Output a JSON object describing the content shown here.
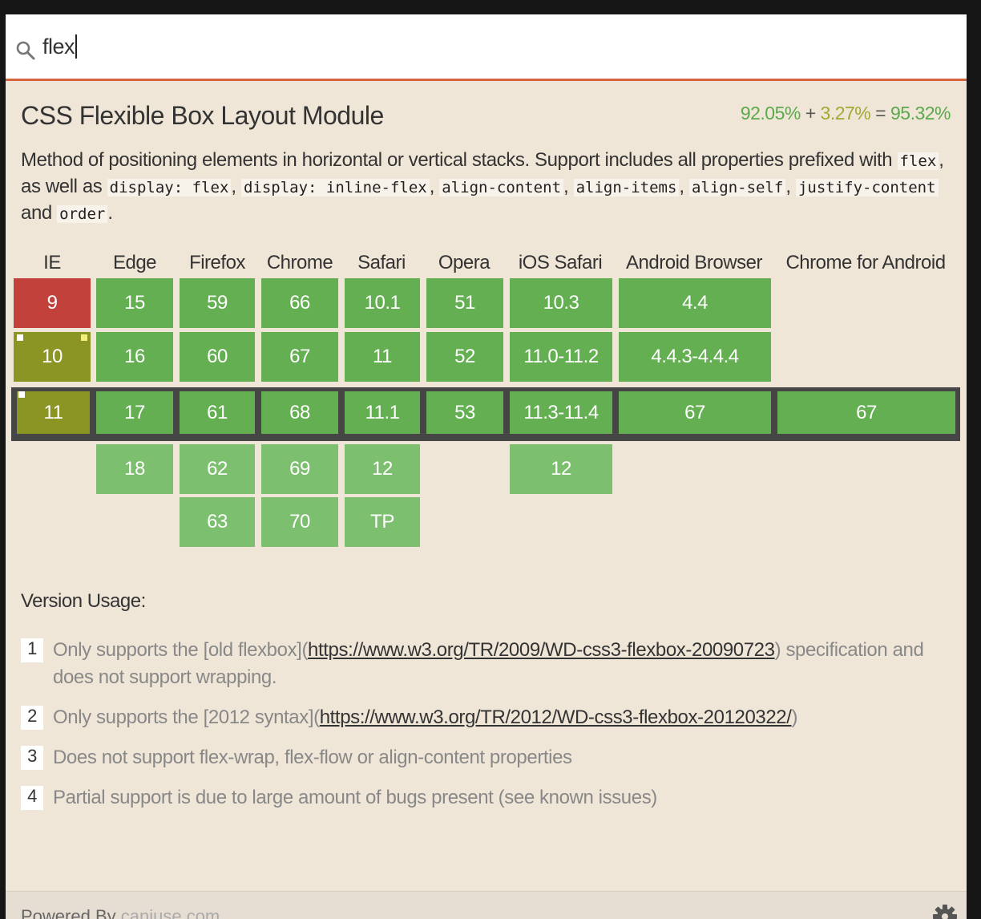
{
  "search": {
    "value": "flex"
  },
  "feature": {
    "title": "CSS Flexible Box Layout Module",
    "usage": {
      "supported": "92.05%",
      "plus": "+",
      "partial": "3.27%",
      "equals": "=",
      "total": "95.32%"
    },
    "description": {
      "prefix": "Method of positioning elements in horizontal or vertical stacks. Support includes all properties prefixed with",
      "code_flex": "flex",
      "as_well_as": ", as well as",
      "code_display_flex": "display: flex",
      "code_display_inline_flex": "display: inline-flex",
      "code_align_content": "align-content",
      "code_align_items": "align-items",
      "code_align_self": "align-self",
      "code_justify_content": "justify-content",
      "and": "and",
      "code_order": "order",
      "comma": ",",
      "period": "."
    }
  },
  "browsers": [
    {
      "name": "IE",
      "versions": {
        "past1": "9",
        "past2": "10",
        "current": "11"
      }
    },
    {
      "name": "Edge",
      "versions": {
        "past1": "15",
        "past2": "16",
        "current": "17",
        "future1": "18"
      }
    },
    {
      "name": "Firefox",
      "versions": {
        "past1": "59",
        "past2": "60",
        "current": "61",
        "future1": "62",
        "future2": "63"
      }
    },
    {
      "name": "Chrome",
      "versions": {
        "past1": "66",
        "past2": "67",
        "current": "68",
        "future1": "69",
        "future2": "70"
      }
    },
    {
      "name": "Safari",
      "versions": {
        "past1": "10.1",
        "past2": "11",
        "current": "11.1",
        "future1": "12",
        "future2": "TP"
      }
    },
    {
      "name": "Opera",
      "versions": {
        "past1": "51",
        "past2": "52",
        "current": "53"
      }
    },
    {
      "name": "iOS Safari",
      "versions": {
        "past1": "10.3",
        "past2": "11.0-11.2",
        "current": "11.3-11.4",
        "future1": "12"
      }
    },
    {
      "name": "Android Browser",
      "versions": {
        "past1": "4.4",
        "past2": "4.4.3-4.4.4",
        "current": "67"
      }
    },
    {
      "name": "Chrome for Android",
      "versions": {
        "current": "67"
      }
    }
  ],
  "colors": {
    "no": "#c2413a",
    "partial": "#8a9524",
    "yes": "#63af52",
    "future": "#7cbf6f",
    "accent": "#d6643c"
  },
  "version_usage": {
    "label": "Version Usage:",
    "notes": [
      {
        "num": "1",
        "before": "Only supports the [old flexbox](",
        "link": "https://www.w3.org/TR/2009/WD-css3-flexbox-20090723",
        "after": ") specification and does not support wrapping."
      },
      {
        "num": "2",
        "before": "Only supports the [2012 syntax](",
        "link": "https://www.w3.org/TR/2012/WD-css3-flexbox-20120322/",
        "after": ")"
      },
      {
        "num": "3",
        "text": "Does not support flex-wrap, flex-flow or align-content properties"
      },
      {
        "num": "4",
        "text": "Partial support is due to large amount of bugs present (see known issues)"
      }
    ]
  },
  "footer": {
    "powered_by": "Powered By",
    "brand": "caniuse.com"
  },
  "icons": {
    "search": "search-icon",
    "settings": "gear-icon"
  }
}
